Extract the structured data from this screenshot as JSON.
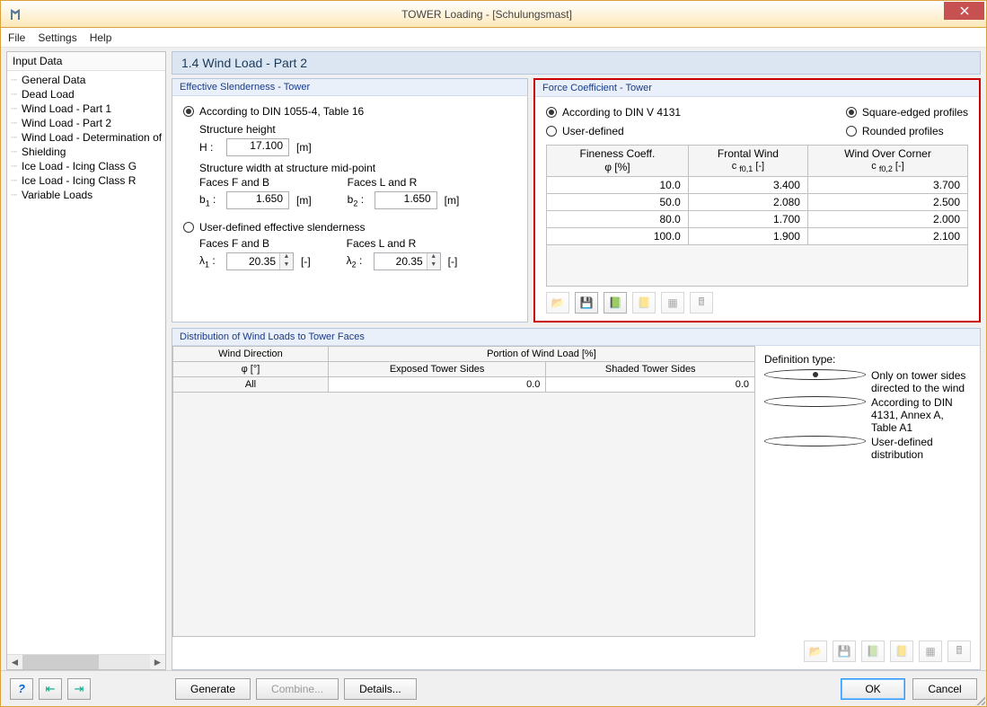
{
  "window": {
    "title": "TOWER Loading - [Schulungsmast]"
  },
  "menu": {
    "file": "File",
    "settings": "Settings",
    "help": "Help"
  },
  "tree": {
    "header": "Input Data",
    "items": [
      "General Data",
      "Dead Load",
      "Wind Load - Part 1",
      "Wind Load - Part 2",
      "Wind Load - Determination of G",
      "Shielding",
      "Ice Load - Icing Class G",
      "Ice Load - Icing Class R",
      "Variable Loads"
    ]
  },
  "main": {
    "title": "1.4 Wind Load - Part 2"
  },
  "slenderness": {
    "title": "Effective Slenderness - Tower",
    "opt_din": "According to DIN 1055-4, Table 16",
    "opt_user": "User-defined effective slenderness",
    "struct_height": "Structure height",
    "H_label": "H :",
    "H_val": "17.100",
    "H_unit": "[m]",
    "struct_width": "Structure width at structure mid-point",
    "faces_fb": "Faces F and B",
    "faces_lr": "Faces L and R",
    "b1_label": "b1 :",
    "b1_val": "1.650",
    "b1_unit": "[m]",
    "b2_label": "b2 :",
    "b2_val": "1.650",
    "b2_unit": "[m]",
    "l1_label": "λ1 :",
    "l1_val": "20.35",
    "l1_unit": "[-]",
    "l2_label": "λ2 :",
    "l2_val": "20.35",
    "l2_unit": "[-]"
  },
  "forcecoeff": {
    "title": "Force Coefficient - Tower",
    "opt_din": "According to DIN V 4131",
    "opt_user": "User-defined",
    "opt_square": "Square-edged profiles",
    "opt_round": "Rounded profiles",
    "th1a": "Fineness Coeff.",
    "th1b": "φ [%]",
    "th2a": "Frontal Wind",
    "th2b": "c f0,1 [-]",
    "th3a": "Wind Over Corner",
    "th3b": "c f0,2 [-]",
    "rows": [
      {
        "p": "10.0",
        "c1": "3.400",
        "c2": "3.700"
      },
      {
        "p": "50.0",
        "c1": "2.080",
        "c2": "2.500"
      },
      {
        "p": "80.0",
        "c1": "1.700",
        "c2": "2.000"
      },
      {
        "p": "100.0",
        "c1": "1.900",
        "c2": "2.100"
      }
    ]
  },
  "distribution": {
    "title": "Distribution of Wind Loads to Tower Faces",
    "th_dir1": "Wind Direction",
    "th_dir2": "φ [°]",
    "th_portion": "Portion of Wind Load [%]",
    "th_exp": "Exposed Tower Sides",
    "th_shd": "Shaded Tower Sides",
    "row_dir": "All",
    "row_exp": "0.0",
    "row_shd": "0.0",
    "def_title": "Definition type:",
    "opt_only": "Only on tower sides directed to the wind",
    "opt_din": "According to DIN 4131, Annex A, Table A1",
    "opt_user": "User-defined distribution"
  },
  "footer": {
    "generate": "Generate",
    "combine": "Combine...",
    "details": "Details...",
    "ok": "OK",
    "cancel": "Cancel"
  }
}
